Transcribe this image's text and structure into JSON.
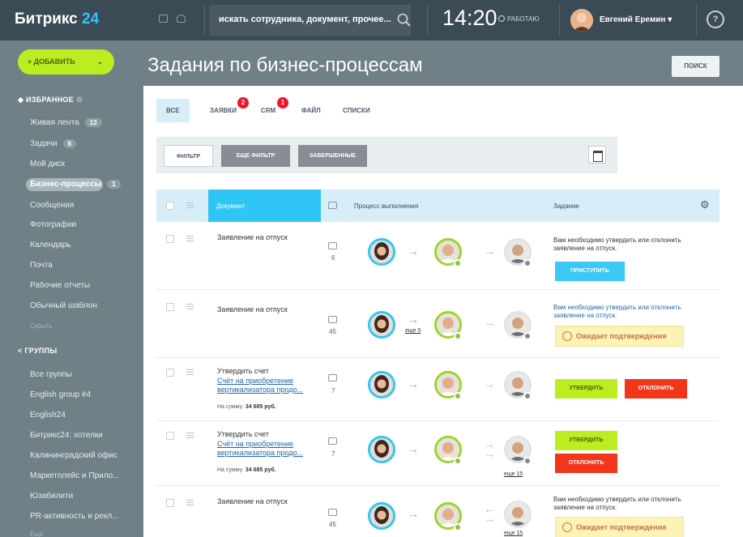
{
  "header": {
    "logo_text": "Битрикс",
    "logo_num": "24",
    "search_placeholder": "искать сотрудника, документ, прочее...",
    "time": "14:20",
    "work_status": "РАБОТАЮ",
    "user_name": "Евгений Еремин",
    "help_label": "?"
  },
  "sidebar": {
    "add_button": "+ ДОБАВИТЬ",
    "favorites_header": "ИЗБРАННОЕ",
    "items": [
      {
        "label": "Живая лента",
        "count": "13"
      },
      {
        "label": "Задачи",
        "count": "6"
      },
      {
        "label": "Мой диск"
      },
      {
        "label": "Бизнес-процессы",
        "count": "1"
      },
      {
        "label": "Сообщения"
      },
      {
        "label": "Фотографии"
      },
      {
        "label": "Календарь"
      },
      {
        "label": "Почта"
      },
      {
        "label": "Рабочие отчеты"
      },
      {
        "label": "Обычный шаблон"
      },
      {
        "label": "Скрыть"
      }
    ],
    "groups_header": "ГРУППЫ",
    "groups": [
      "Все группы",
      "English group #4",
      "English24",
      "Битрикс24: хотелки",
      "Калининградский офис",
      "Маркетплейс и Прило...",
      "Юзабилити",
      "PR-активность и рекл...",
      "Ещё"
    ]
  },
  "main": {
    "title": "Задания по бизнес-процессам",
    "search_button": "ПОИСК",
    "tabs": [
      {
        "label": "ВСЕ"
      },
      {
        "label": "ЗАЯВКИ",
        "badge": "2"
      },
      {
        "label": "CRM",
        "badge": "1"
      },
      {
        "label": "ФАЙЛ"
      },
      {
        "label": "СПИСКИ"
      }
    ],
    "filters": {
      "filter": "ФИЛЬТР",
      "more_filter": "ЕЩЕ ФИЛЬТР",
      "completed": "ЗАВЕРШЕННЫЕ"
    },
    "columns": {
      "document": "Документ",
      "process": "Процесс выполнения",
      "task": "Задание"
    },
    "rows": [
      {
        "title": "Заявление на отпуск",
        "comments": "6",
        "task": "Вам необходимо утвердить или отклонить заявление на отпуск.",
        "action": "ПРИСТУПИТЬ"
      },
      {
        "title": "Заявление на отпуск",
        "comments": "45",
        "more": "еще 5",
        "task": "Вам необходимо утвердить или отклонить заявление на отпуск.",
        "wait": "Ожидает подтверждения"
      },
      {
        "title": "Утвердить счет",
        "link": "Счёт на приобретение вертикализатора продо...",
        "sum_label": "На сумму:",
        "sum_value": "34 685 руб.",
        "comments": "7",
        "approve": "УТВЕРДИТЬ",
        "reject": "ОТКЛОНИТЬ"
      },
      {
        "title": "Утвердить счет",
        "link": "Счёт на приобретение вертикализатора продо...",
        "sum_label": "На сумму:",
        "sum_value": "34 685 руб.",
        "comments": "7",
        "more": "еще 15",
        "approve": "УТВЕРДИТЬ",
        "reject": "ОТКЛОНИТЬ"
      },
      {
        "title": "Заявление на отпуск",
        "comments": "45",
        "more": "еще 15",
        "task": "Вам необходимо утвердить или отклонить заявление на отпуск.",
        "wait": "Ожидает подтверждения"
      }
    ]
  }
}
